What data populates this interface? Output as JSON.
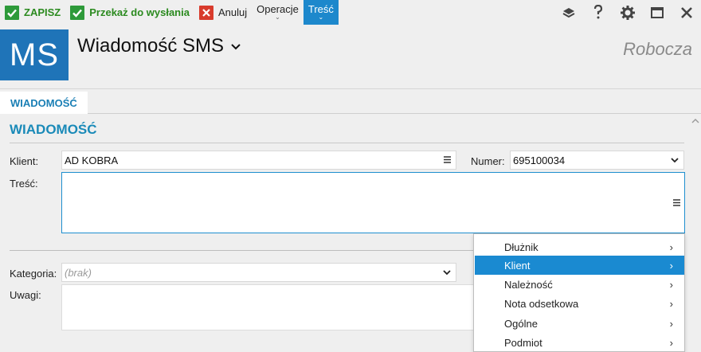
{
  "toolbar": {
    "save": "ZAPISZ",
    "send": "Przekaż do wysłania",
    "cancel": "Anuluj",
    "operations": "Operacje",
    "content": "Treść"
  },
  "header": {
    "logo": "MS",
    "title": "Wiadomość SMS",
    "state": "Robocza"
  },
  "tabs": [
    {
      "label": "WIADOMOŚĆ",
      "active": true
    }
  ],
  "form": {
    "section_title": "WIADOMOŚĆ",
    "client_label": "Klient:",
    "client_value": "AD KOBRA",
    "number_label": "Numer:",
    "number_value": "695100034",
    "content_label": "Treść:",
    "content_value": "",
    "category_label": "Kategoria:",
    "category_value": "(brak)",
    "notes_label": "Uwagi:",
    "notes_value": ""
  },
  "menu": {
    "items": [
      {
        "label": "Dłużnik",
        "highlighted": false
      },
      {
        "label": "Klient",
        "highlighted": true
      },
      {
        "label": "Należność",
        "highlighted": false
      },
      {
        "label": "Nota odsetkowa",
        "highlighted": false
      },
      {
        "label": "Ogólne",
        "highlighted": false
      },
      {
        "label": "Podmiot",
        "highlighted": false
      }
    ]
  },
  "colors": {
    "accent": "#1a8ad1",
    "logo_bg": "#1f74b8",
    "section_title": "#1a8ab8",
    "save_green": "#2e9a3a",
    "cancel_red": "#d83b2c"
  },
  "icons": {
    "save": "check-icon",
    "send": "check-icon",
    "cancel": "close-icon",
    "help": "help-icon",
    "settings": "gear-icon",
    "maximize": "maximize-icon",
    "close": "close-icon",
    "layers": "layers-icon",
    "list": "list-icon",
    "dropdown": "chevron-down-icon",
    "submenu": "chevron-right-icon"
  }
}
